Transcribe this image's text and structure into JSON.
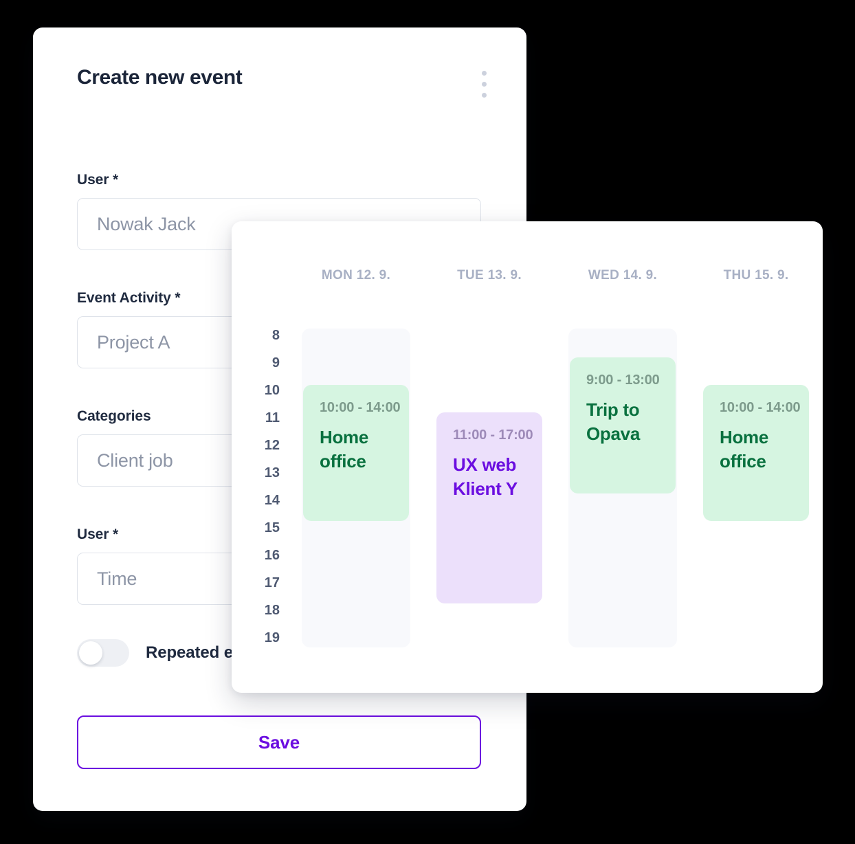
{
  "form": {
    "title": "Create new event",
    "menu_icon": "kebab-menu-icon",
    "fields": [
      {
        "label": "User *",
        "placeholder": "Nowak Jack"
      },
      {
        "label": "Event Activity *",
        "placeholder": "Project A"
      },
      {
        "label": "Categories",
        "placeholder": "Client job"
      },
      {
        "label": "User *",
        "placeholder": "Time"
      }
    ],
    "toggle": {
      "label": "Repeated e",
      "state": "off"
    },
    "save_label": "Save"
  },
  "calendar": {
    "days": [
      {
        "label": "MON 12. 9."
      },
      {
        "label": "TUE 13. 9."
      },
      {
        "label": "WED 14. 9."
      },
      {
        "label": "THU 15. 9."
      }
    ],
    "hours": [
      "8",
      "9",
      "10",
      "11",
      "12",
      "13",
      "14",
      "15",
      "16",
      "17",
      "18",
      "19"
    ],
    "events": [
      {
        "day": 0,
        "time": "10:00 - 14:00",
        "title": "Home office",
        "color": "green"
      },
      {
        "day": 1,
        "time": "11:00 - 17:00",
        "title": "UX web Klient Y",
        "color": "purple"
      },
      {
        "day": 2,
        "time": "9:00 - 13:00",
        "title": "Trip to Opava",
        "color": "green"
      },
      {
        "day": 3,
        "time": "10:00 - 14:00",
        "title": "Home office",
        "color": "green"
      }
    ]
  },
  "colors": {
    "accent_purple": "#6b0ee0",
    "event_green_bg": "#d6f5e1",
    "event_green_text": "#09713f",
    "event_purple_bg": "#ece0fb",
    "event_purple_text": "#6b0ee0",
    "track_bg": "#f8f9fc",
    "title_text": "#1b2539"
  }
}
